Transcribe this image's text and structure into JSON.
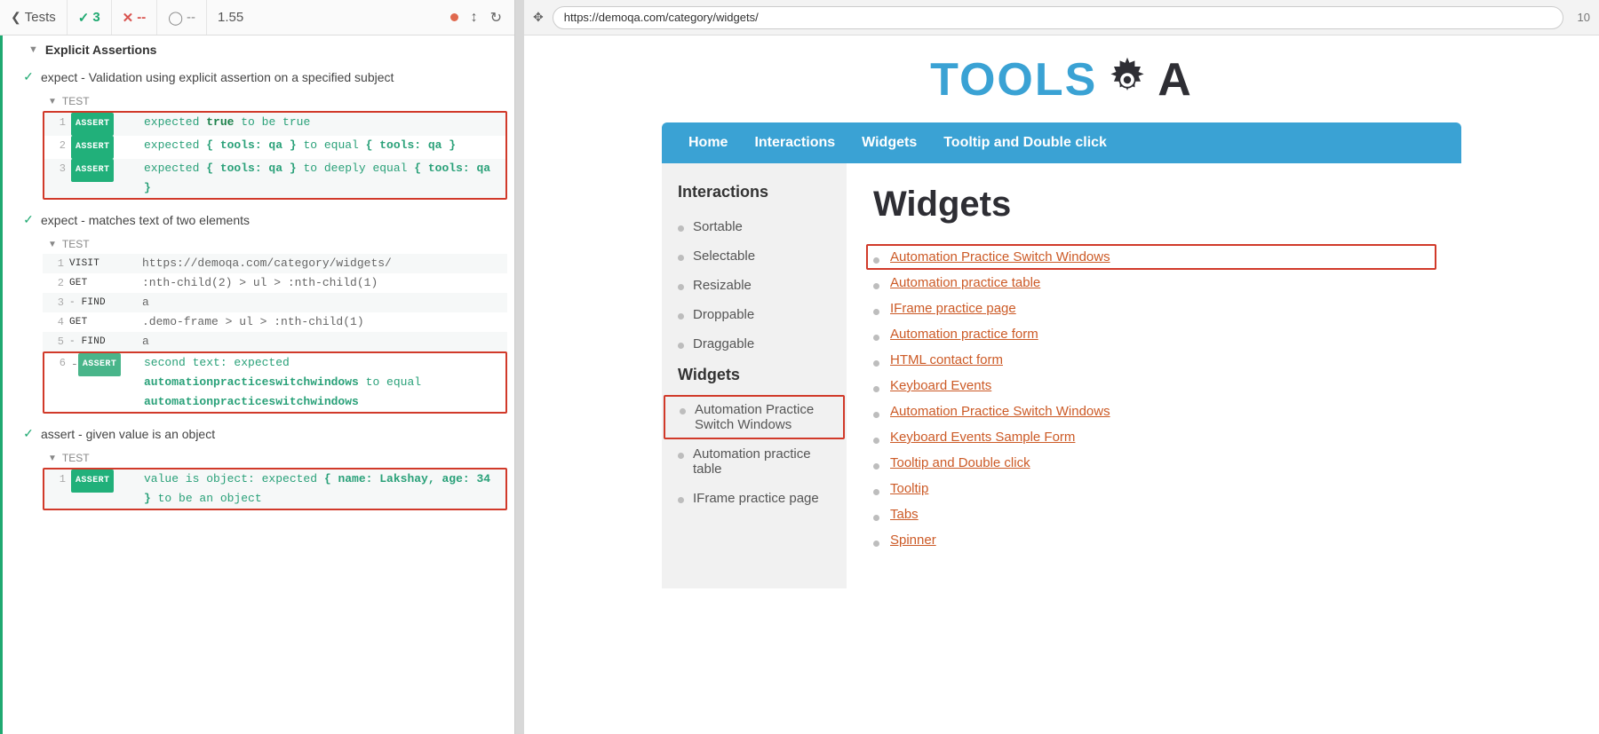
{
  "toolbar": {
    "tests_label": "Tests",
    "pass_count": "3",
    "fail_count": "--",
    "pending_count": "--",
    "duration": "1.55",
    "zoom": "10"
  },
  "url": "https://demoqa.com/category/widgets/",
  "spec_title": "Explicit Assertions",
  "tests": [
    {
      "title": "expect - Validation using explicit assertion on a specified subject",
      "body_highlight": true,
      "label": "TEST",
      "cmds": [
        {
          "n": "1",
          "type": "assert",
          "msg": "expected ",
          "tokens": [
            {
              "t": "expected ",
              "c": "plain"
            },
            {
              "t": "true",
              "c": "kw"
            },
            {
              "t": " to be true",
              "c": "plain"
            }
          ]
        },
        {
          "n": "2",
          "type": "assert",
          "tokens": [
            {
              "t": "expected ",
              "c": "plain"
            },
            {
              "t": "{ tools: qa }",
              "c": "obj"
            },
            {
              "t": " to equal ",
              "c": "plain"
            },
            {
              "t": "{ tools: qa }",
              "c": "obj"
            }
          ]
        },
        {
          "n": "3",
          "type": "assert",
          "tokens": [
            {
              "t": "expected ",
              "c": "plain"
            },
            {
              "t": "{ tools: qa }",
              "c": "obj"
            },
            {
              "t": " to deeply equal ",
              "c": "plain"
            },
            {
              "t": "{ tools: qa }",
              "c": "obj"
            }
          ]
        }
      ]
    },
    {
      "title": "expect - matches text of two elements",
      "body_highlight": false,
      "label": "TEST",
      "cmds": [
        {
          "n": "1",
          "type": "cmd",
          "name": "VISIT",
          "msg": "https://demoqa.com/category/widgets/",
          "cls": "url"
        },
        {
          "n": "2",
          "type": "cmd",
          "name": "GET",
          "msg": ":nth-child(2) > ul > :nth-child(1)",
          "cls": "sel"
        },
        {
          "n": "3",
          "type": "cmd",
          "sub": true,
          "name": "FIND",
          "msg": "a",
          "cls": "sel"
        },
        {
          "n": "4",
          "type": "cmd",
          "name": "GET",
          "msg": ".demo-frame > ul > :nth-child(1)",
          "cls": "sel"
        },
        {
          "n": "5",
          "type": "cmd",
          "sub": true,
          "name": "FIND",
          "msg": "a",
          "cls": "sel"
        },
        {
          "n": "6",
          "type": "dash-assert",
          "highlight": true,
          "tokens": [
            {
              "t": "second text: expected ",
              "c": "plain"
            },
            {
              "t": "automationpracticeswitchwindows",
              "c": "val"
            },
            {
              "t": " to equal ",
              "c": "plain"
            },
            {
              "t": "automationpracticeswitchwindows",
              "c": "val"
            }
          ]
        }
      ]
    },
    {
      "title": "assert - given value is an object",
      "body_highlight": true,
      "label": "TEST",
      "cmds": [
        {
          "n": "1",
          "type": "assert",
          "tokens": [
            {
              "t": "value is object: expected ",
              "c": "plain"
            },
            {
              "t": "{ name: Lakshay, age: 34 }",
              "c": "obj"
            },
            {
              "t": " to be an object",
              "c": "plain"
            }
          ]
        }
      ]
    }
  ],
  "aut": {
    "logo_part1": "TOOLS",
    "logo_part2": "A",
    "nav": [
      "Home",
      "Interactions",
      "Widgets",
      "Tooltip and Double click"
    ],
    "sidebar": [
      {
        "head": "Interactions",
        "items": [
          {
            "label": "Sortable"
          },
          {
            "label": "Selectable"
          },
          {
            "label": "Resizable"
          },
          {
            "label": "Droppable"
          },
          {
            "label": "Draggable"
          }
        ]
      },
      {
        "head": "Widgets",
        "items": [
          {
            "label": "Automation Practice Switch Windows",
            "highlight": true
          },
          {
            "label": "Automation practice table"
          },
          {
            "label": "IFrame practice page"
          }
        ]
      }
    ],
    "page_title": "Widgets",
    "links": [
      {
        "label": "Automation Practice Switch Windows",
        "highlight": true
      },
      {
        "label": "Automation practice table"
      },
      {
        "label": "IFrame practice page"
      },
      {
        "label": "Automation practice form"
      },
      {
        "label": "HTML contact form"
      },
      {
        "label": "Keyboard Events"
      },
      {
        "label": "Automation Practice Switch Windows"
      },
      {
        "label": "Keyboard Events Sample Form"
      },
      {
        "label": "Tooltip and Double click"
      },
      {
        "label": "Tooltip"
      },
      {
        "label": "Tabs"
      },
      {
        "label": "Spinner"
      }
    ]
  }
}
